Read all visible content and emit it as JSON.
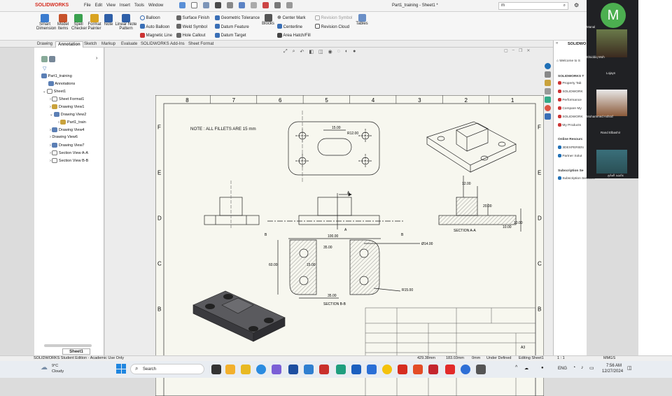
{
  "app": {
    "logo": "SOLIDWORKS",
    "menus": [
      "File",
      "Edit",
      "View",
      "Insert",
      "Tools",
      "Window"
    ],
    "doc_title": "Part1_training - Sheet1 *",
    "search_value": "m"
  },
  "ribbon": {
    "big": [
      {
        "l1": "Smart",
        "l2": "Dimension"
      },
      {
        "l1": "Model",
        "l2": "Items"
      },
      {
        "l1": "Spell",
        "l2": "Checker"
      },
      {
        "l1": "Format",
        "l2": "Painter"
      },
      {
        "l1": "Note",
        "l2": ""
      },
      {
        "l1": "Linear Note",
        "l2": "Pattern"
      }
    ],
    "c1": [
      "Balloon",
      "Auto Balloon",
      "Magnetic Line"
    ],
    "c2": [
      "Surface Finish",
      "Weld Symbol",
      "Hole Callout"
    ],
    "c3": [
      "Geometric Tolerance",
      "Datum Feature",
      "Datum Target"
    ],
    "blocks": "Blocks",
    "c4": [
      "Center Mark",
      "Centerline",
      "Area Hatch/Fill"
    ],
    "c5": [
      "Revision Symbol",
      "Revision Cloud"
    ],
    "tables": "Tables"
  },
  "tabs": [
    "Drawing",
    "Annotation",
    "Sketch",
    "Markup",
    "Evaluate",
    "SOLIDWORKS Add-Ins",
    "Sheet Format"
  ],
  "tree": [
    "Part1_training",
    "Annotations",
    "Sheet1",
    "Sheet Format1",
    "Drawing View1",
    "Drawing View2",
    "Part1_train",
    "Drawing View4",
    "Drawing View6",
    "Drawing View7",
    "Section View A-A",
    "Section View B-B"
  ],
  "sheet_tab": "Sheet1",
  "drawing": {
    "cols": [
      "8",
      "7",
      "6",
      "5",
      "4",
      "3",
      "2",
      "1"
    ],
    "rows": [
      "F",
      "E",
      "D",
      "C",
      "B"
    ],
    "note": "NOTE : ALL FILLETS ARE 15 mm",
    "dims": {
      "d15": "15.00",
      "r12": "R12.00",
      "d12": "12.00",
      "d20": "20.00",
      "d10a": "10.00",
      "d10b": "10.00",
      "d100": "100.00",
      "d35a": "35.00",
      "d14": "Ø14.00",
      "d60": "60.00",
      "d15b": "15.00",
      "d35b": "35.00",
      "r15": "R15.00"
    },
    "labels": {
      "secA": "SECTION A-A",
      "secB": "SECTION B-B",
      "A1": "A",
      "A2": "A",
      "B1": "B",
      "B2": "B",
      "sheetsize": "A3"
    }
  },
  "taskpane": {
    "welcome": "Welcome to S",
    "hdr1": "SOLIDWORKS T",
    "items1": [
      "Property Tab",
      "SOLIDWORK",
      "Performance",
      "Compare My",
      "SOLIDWORK",
      "My Products"
    ],
    "hdr2": "Online Resourc",
    "items2": [
      "3DEXPERIEN",
      "Partner Solut"
    ],
    "hdr3": "Subscription Se",
    "items3": [
      "Subscription Services"
    ]
  },
  "status": {
    "edition": "SOLIDWORKS Student Edition - Academic Use Only",
    "x": "429.38mm",
    "y": "183.03mm",
    "z": "0mm",
    "state": "Under Defined",
    "editing": "Editing Sheet1",
    "scale": "1 : 1",
    "units": "MMGS"
  },
  "taskbar": {
    "temp": "9°C",
    "weather": "Cloudy",
    "search": "Search",
    "lang": "ENG",
    "time": "7:56 AM",
    "date": "12/27/2024"
  },
  "meet": {
    "avatar_letter": "M",
    "names": [
      "Manal",
      "Elsiddiq Moh",
      "Lojayn",
      "Mohammed Ashraf",
      "Rand Elbashir",
      "عائشة الفاتح"
    ]
  },
  "colors": {
    "sw_red": "#d52b1e",
    "sheet": "#f7f7ef",
    "accent": "#1f6fb6",
    "meet_bg": "#202124",
    "avatar": "#4caf50"
  }
}
